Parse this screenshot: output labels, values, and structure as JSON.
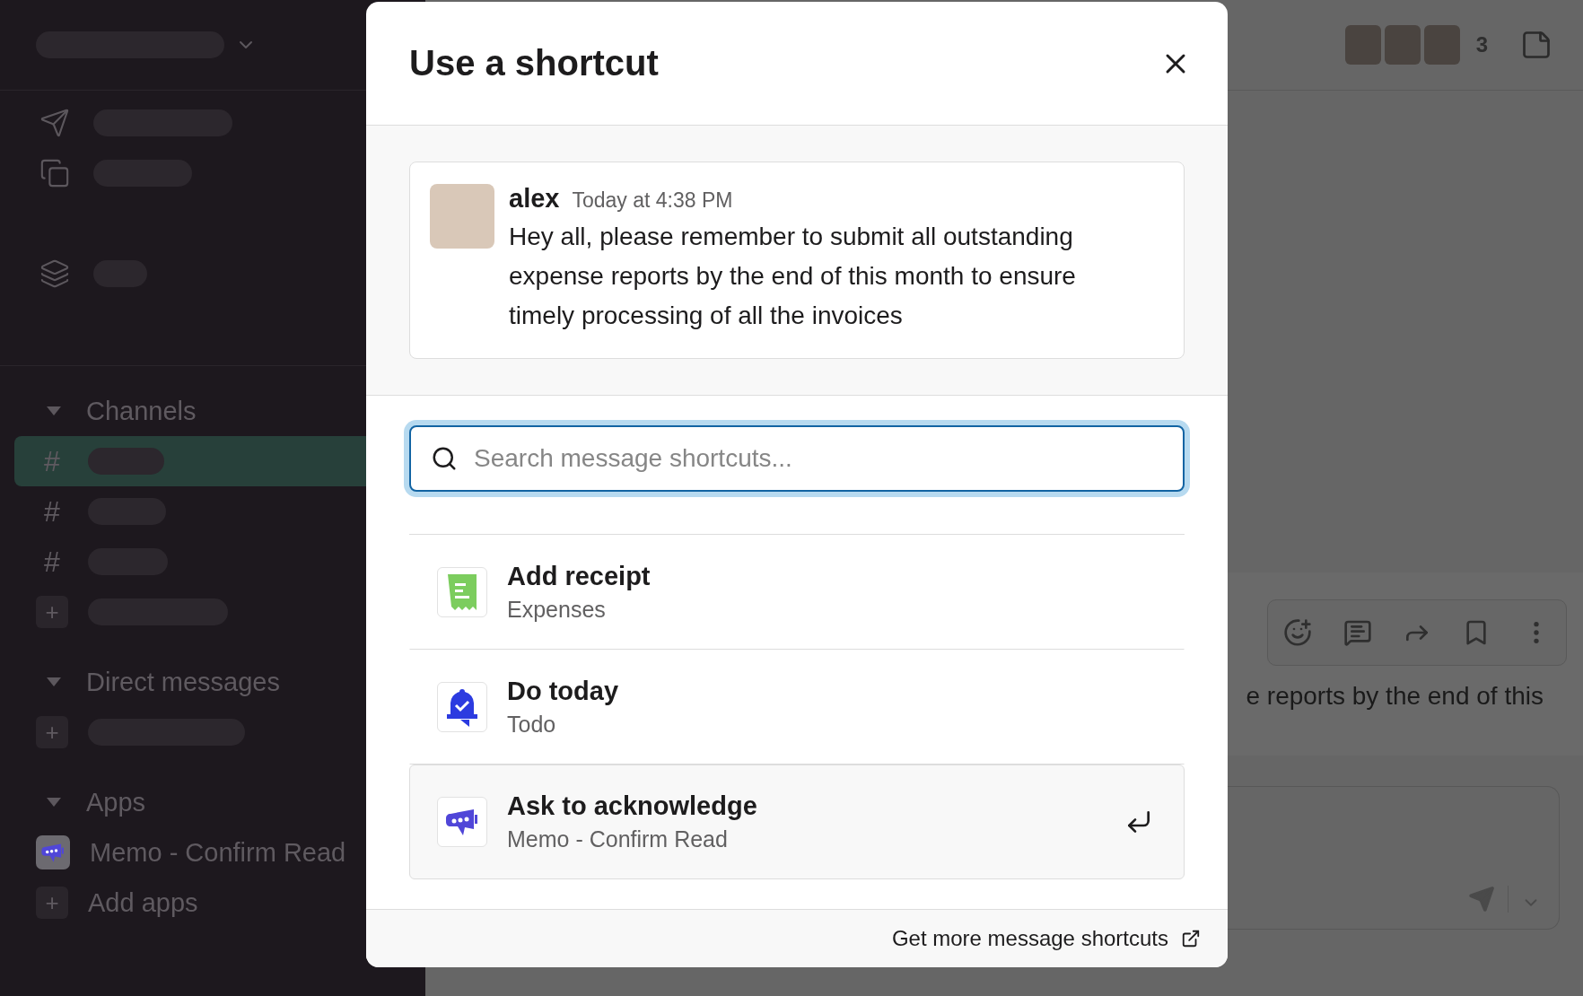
{
  "sidebar": {
    "sections": [
      {
        "title": "Channels",
        "expanded": true,
        "items": [
          {
            "kind": "channel",
            "icon": "#",
            "selected": true
          },
          {
            "kind": "channel",
            "icon": "#",
            "selected": false
          },
          {
            "kind": "channel",
            "icon": "#",
            "selected": false
          },
          {
            "kind": "add",
            "icon": "+",
            "selected": false
          }
        ]
      },
      {
        "title": "Direct messages",
        "expanded": true,
        "items": [
          {
            "kind": "add",
            "icon": "+",
            "selected": false
          }
        ]
      },
      {
        "title": "Apps",
        "expanded": true,
        "items": [
          {
            "kind": "app",
            "label": "Memo - Confirm Read",
            "selected": false
          },
          {
            "kind": "add",
            "icon": "+",
            "label": "Add apps",
            "selected": false
          }
        ]
      }
    ]
  },
  "header": {
    "member_count": "3"
  },
  "background_message": {
    "text": "e reports by the end of this"
  },
  "modal": {
    "title": "Use a shortcut",
    "message": {
      "author": "alex",
      "time": "Today at 4:38 PM",
      "text": "Hey all, please remember to submit all outstanding expense reports by the end of this month to ensure timely processing of all the invoices"
    },
    "search": {
      "placeholder": "Search message shortcuts..."
    },
    "shortcuts": [
      {
        "kind": "receipt",
        "title": "Add receipt",
        "app": "Expenses",
        "selected": false
      },
      {
        "kind": "bell",
        "title": "Do today",
        "app": "Todo",
        "selected": false
      },
      {
        "kind": "megaphone",
        "title": "Ask to acknowledge",
        "app": "Memo - Confirm Read",
        "selected": true
      }
    ],
    "footer_link": "Get more message shortcuts"
  }
}
